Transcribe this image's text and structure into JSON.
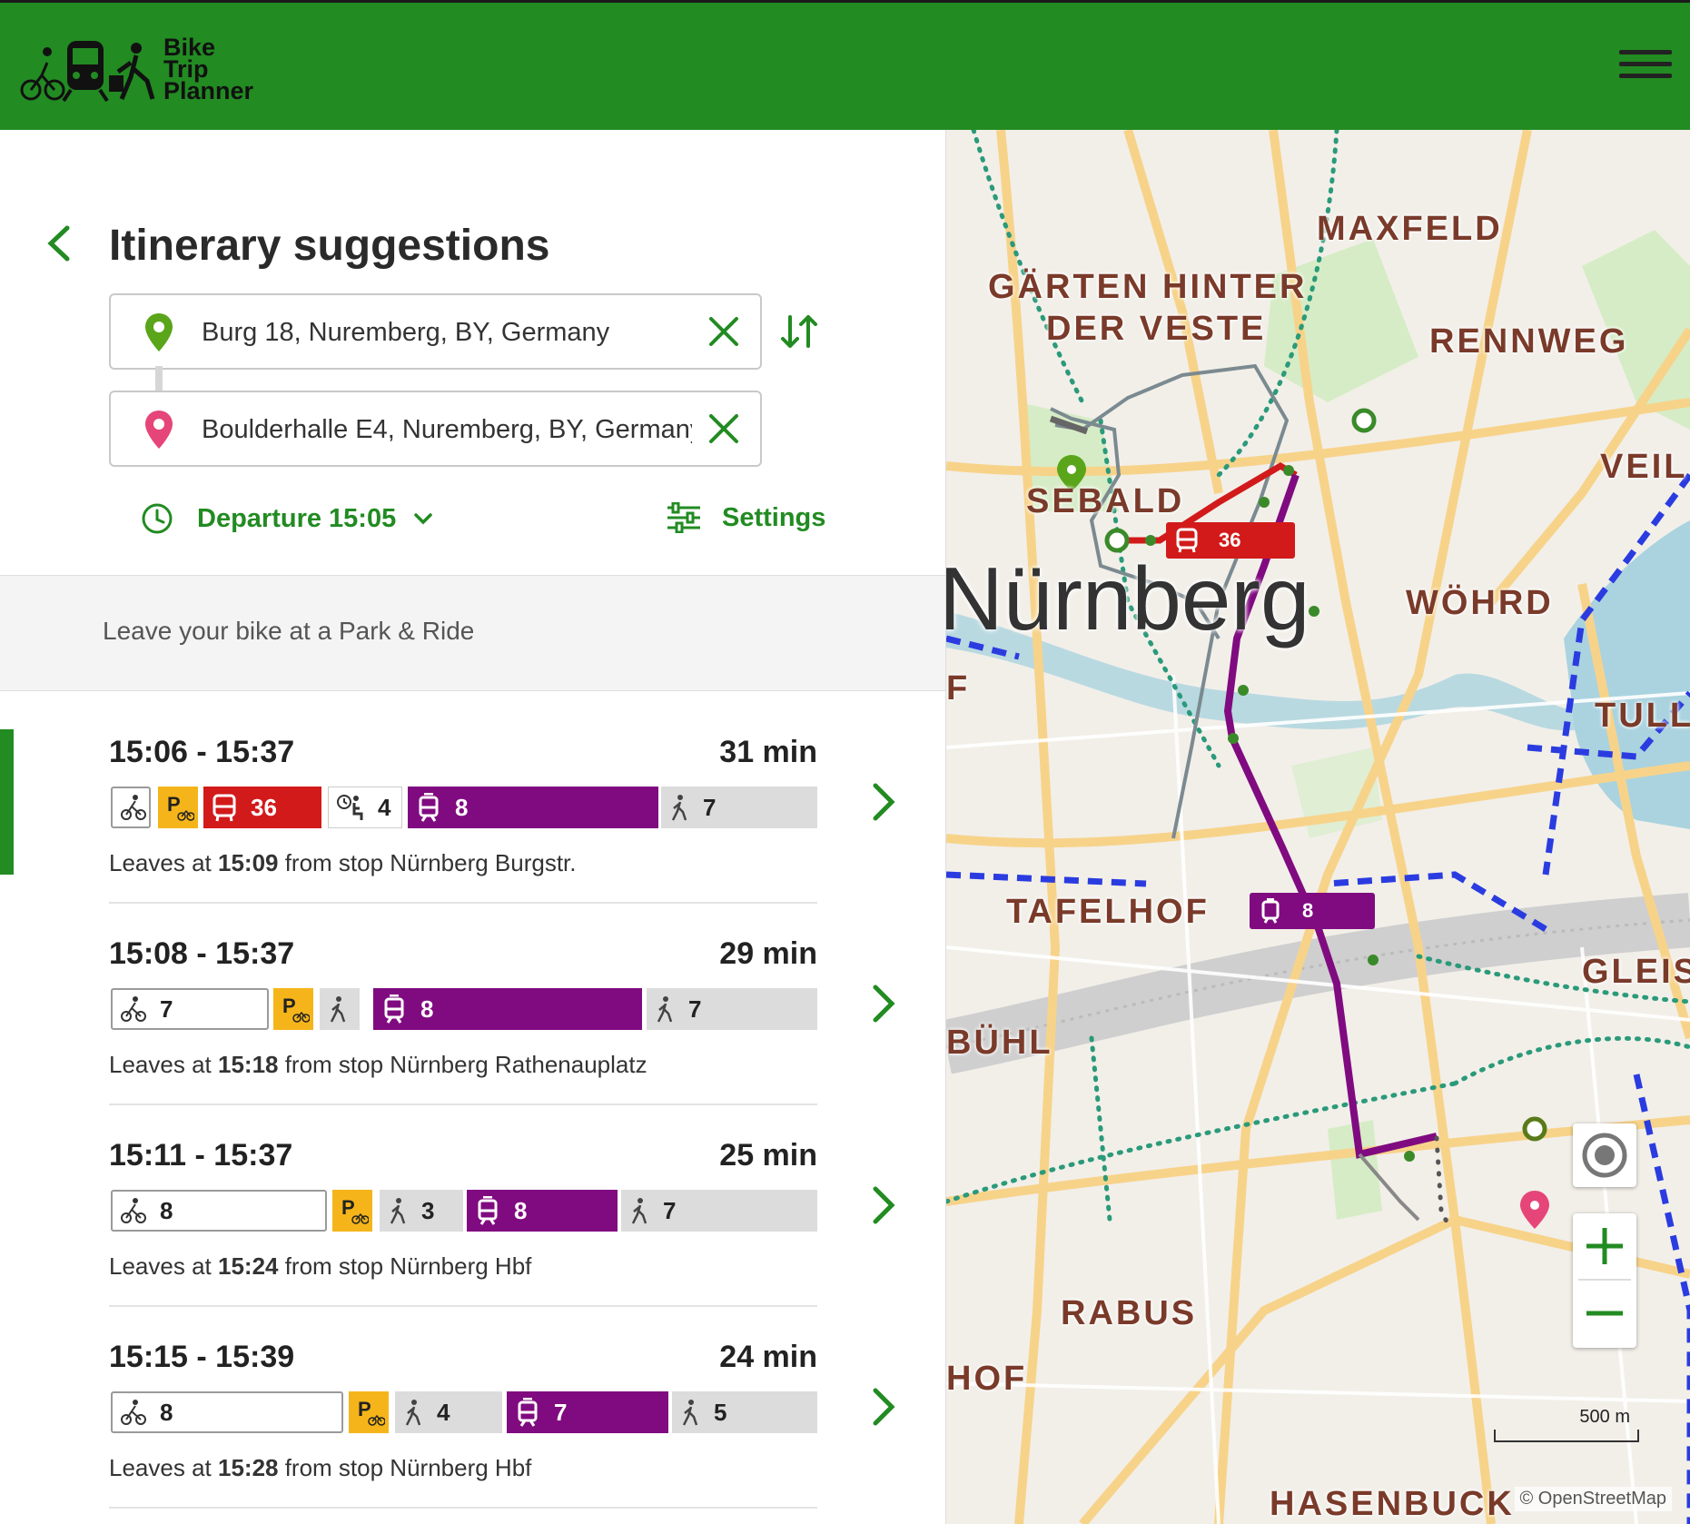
{
  "app": {
    "name_line1": "Bike",
    "name_line2": "Trip",
    "name_line3": "Planner"
  },
  "page": {
    "title": "Itinerary suggestions"
  },
  "search": {
    "origin": "Burg 18, Nuremberg, BY, Germany",
    "destination": "Boulderhalle E4, Nuremberg, BY, Germany"
  },
  "departure_label": "Departure 15:05",
  "settings_label": "Settings",
  "hint": "Leave your bike at a Park & Ride",
  "colors": {
    "brand": "#228b22",
    "bus": "#d21a1a",
    "tram": "#800b80",
    "park": "#f5b51a",
    "walk": "#dcdcdc"
  },
  "itineraries": [
    {
      "time": "15:06 - 15:37",
      "duration": "31 min",
      "leaves_prefix": "Leaves at ",
      "leaves_time": "15:09",
      "leaves_suffix": " from stop Nürnberg Burgstr.",
      "legs": [
        {
          "type": "bike",
          "value": ""
        },
        {
          "type": "park",
          "value": ""
        },
        {
          "type": "bus",
          "value": "36"
        },
        {
          "type": "wait",
          "value": "4"
        },
        {
          "type": "tram",
          "value": "8"
        },
        {
          "type": "walk",
          "value": "7"
        }
      ]
    },
    {
      "time": "15:08 - 15:37",
      "duration": "29 min",
      "leaves_prefix": "Leaves at ",
      "leaves_time": "15:18",
      "leaves_suffix": " from stop Nürnberg Rathenauplatz",
      "legs": [
        {
          "type": "bike",
          "value": "7"
        },
        {
          "type": "park",
          "value": ""
        },
        {
          "type": "walk",
          "value": ""
        },
        {
          "type": "tram",
          "value": "8"
        },
        {
          "type": "walk",
          "value": "7"
        }
      ]
    },
    {
      "time": "15:11 - 15:37",
      "duration": "25 min",
      "leaves_prefix": "Leaves at ",
      "leaves_time": "15:24",
      "leaves_suffix": " from stop Nürnberg Hbf",
      "legs": [
        {
          "type": "bike",
          "value": "8"
        },
        {
          "type": "park",
          "value": ""
        },
        {
          "type": "walk",
          "value": "3"
        },
        {
          "type": "tram",
          "value": "8"
        },
        {
          "type": "walk",
          "value": "7"
        }
      ]
    },
    {
      "time": "15:15 - 15:39",
      "duration": "24 min",
      "leaves_prefix": "Leaves at ",
      "leaves_time": "15:28",
      "leaves_suffix": " from stop Nürnberg Hbf",
      "legs": [
        {
          "type": "bike",
          "value": "8"
        },
        {
          "type": "park",
          "value": ""
        },
        {
          "type": "walk",
          "value": "4"
        },
        {
          "type": "tram",
          "value": "7"
        },
        {
          "type": "walk",
          "value": "5"
        }
      ]
    }
  ],
  "map": {
    "labels": {
      "maxfeld": "MAXFELD",
      "gaerten1": "GÄRTEN HINTER",
      "gaerten2": "DER VESTE",
      "rennweg": "RENNWEG",
      "veil": "VEIL",
      "sebald": "SEBALD",
      "nuernberg": "Nürnberg",
      "woehrd": "WÖHRD",
      "tull": "TULL",
      "f": "F",
      "tafelhof": "TAFELHOF",
      "gleis": "GLEIS",
      "buehl": "BÜHL",
      "rabus": "RABUS",
      "hof": "HOF",
      "hasenbuck": "HASENBUCK"
    },
    "route_badges": {
      "bus": "36",
      "tram": "8"
    },
    "scale": "500 m",
    "attribution": "© OpenStreetMap"
  }
}
